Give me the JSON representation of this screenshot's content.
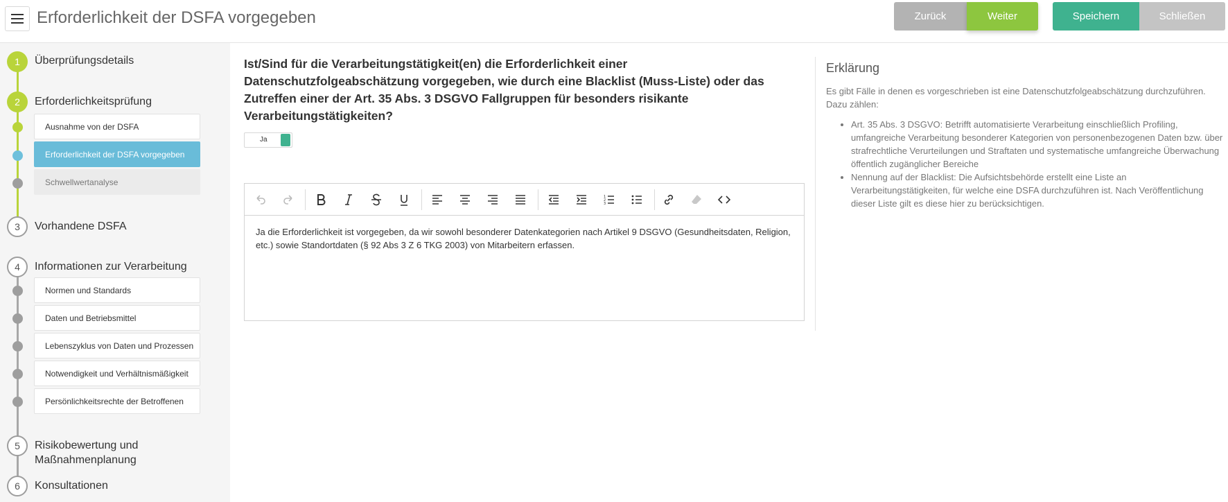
{
  "header": {
    "title": "Erforderlichkeit der DSFA vorgegeben",
    "buttons": {
      "back": "Zurück",
      "next": "Weiter",
      "save": "Speichern",
      "close": "Schließen"
    }
  },
  "sidebar": {
    "steps": [
      {
        "number": "1",
        "label": "Überprüfungsdetails"
      },
      {
        "number": "2",
        "label": "Erforderlichkeitsprüfung"
      },
      {
        "number": "3",
        "label": "Vorhandene DSFA"
      },
      {
        "number": "4",
        "label": "Informationen zur Verarbeitung"
      },
      {
        "number": "5",
        "label": "Risikobewertung und Maßnahmenplanung"
      },
      {
        "number": "6",
        "label": "Konsultationen"
      }
    ],
    "step2_items": [
      {
        "label": "Ausnahme von der DSFA"
      },
      {
        "label": "Erforderlichkeit der DSFA vorgegeben"
      },
      {
        "label": "Schwellwertanalyse"
      }
    ],
    "step4_items": [
      {
        "label": "Normen und Standards"
      },
      {
        "label": "Daten und Betriebsmittel"
      },
      {
        "label": "Lebenszyklus von Daten und Prozessen"
      },
      {
        "label": "Notwendigkeit und Verhältnismäßigkeit"
      },
      {
        "label": "Persönlichkeitsrechte der Betroffenen"
      }
    ]
  },
  "main": {
    "question": "Ist/Sind für die Verarbeitungstätigkeit(en) die Erforderlichkeit einer Datenschutzfolgeabschätzung vorgegeben, wie durch eine Blacklist (Muss-Liste) oder das Zutreffen einer der Art. 35 Abs. 3 DSGVO Fallgruppen für besonders risikante Verarbeitungstätigkeiten?",
    "toggle_label": "Ja",
    "editor_text": "Ja die Erforderlichkeit ist vorgegeben, da wir sowohl besonderer Datenkategorien nach Artikel 9 DSGVO (Gesundheitsdaten, Religion, etc.) sowie Standortdaten (§ 92 Abs 3 Z 6 TKG 2003) von Mitarbeitern erfassen."
  },
  "explanation": {
    "title": "Erklärung",
    "intro": "Es gibt Fälle in denen es vorgeschrieben ist eine Datenschutzfolgeabschätzung durchzuführen. Dazu zählen:",
    "items": [
      "Art. 35 Abs. 3 DSGVO: Betrifft automatisierte Verarbeitung einschließlich Profiling, umfangreiche Verarbeitung besonderer Kategorien von personenbezogenen Daten bzw. über strafrechtliche Verurteilungen und Straftaten und systematische umfangreiche Überwachung öffentlich zugänglicher Bereiche",
      "Nennung auf der Blacklist: Die Aufsichtsbehörde erstellt eine Liste an Verarbeitungstätigkeiten, für welche eine DSFA durchzuführen ist. Nach Veröffentlichung dieser Liste gilt es diese hier zu berücksichtigen."
    ]
  },
  "colors": {
    "green": "#8dc63f",
    "teal": "#3fb28f",
    "blue_active": "#69bcd9",
    "grey_button": "#b3b3b3"
  }
}
